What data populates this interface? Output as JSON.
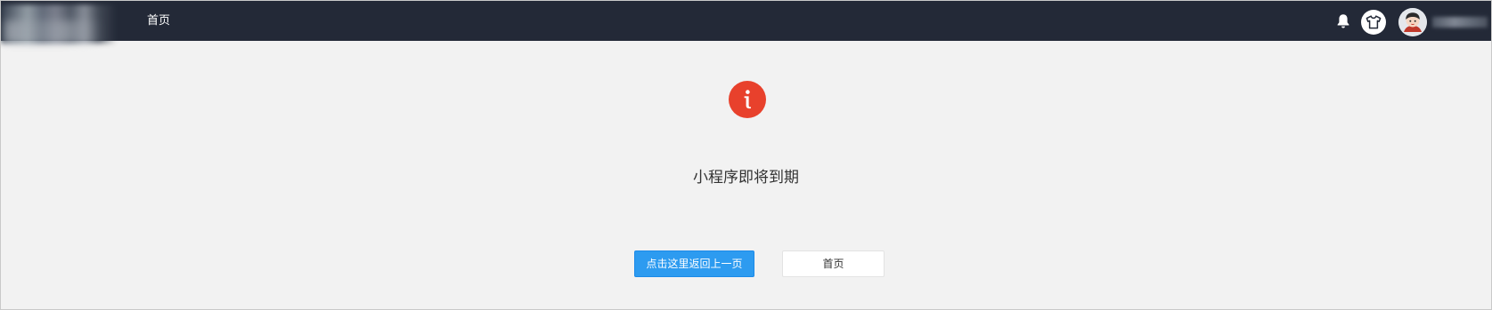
{
  "header": {
    "nav_home_label": "首页",
    "icons": {
      "notification": "bell-icon",
      "theme": "tshirt-icon",
      "user": "avatar"
    }
  },
  "notice": {
    "icon": "info-icon",
    "icon_color": "#e8412c",
    "message": "小程序即将到期"
  },
  "actions": {
    "back_label": "点击这里返回上一页",
    "home_label": "首页"
  },
  "colors": {
    "topbar": "#232937",
    "background": "#f2f2f2",
    "primary": "#2d9bf0"
  }
}
